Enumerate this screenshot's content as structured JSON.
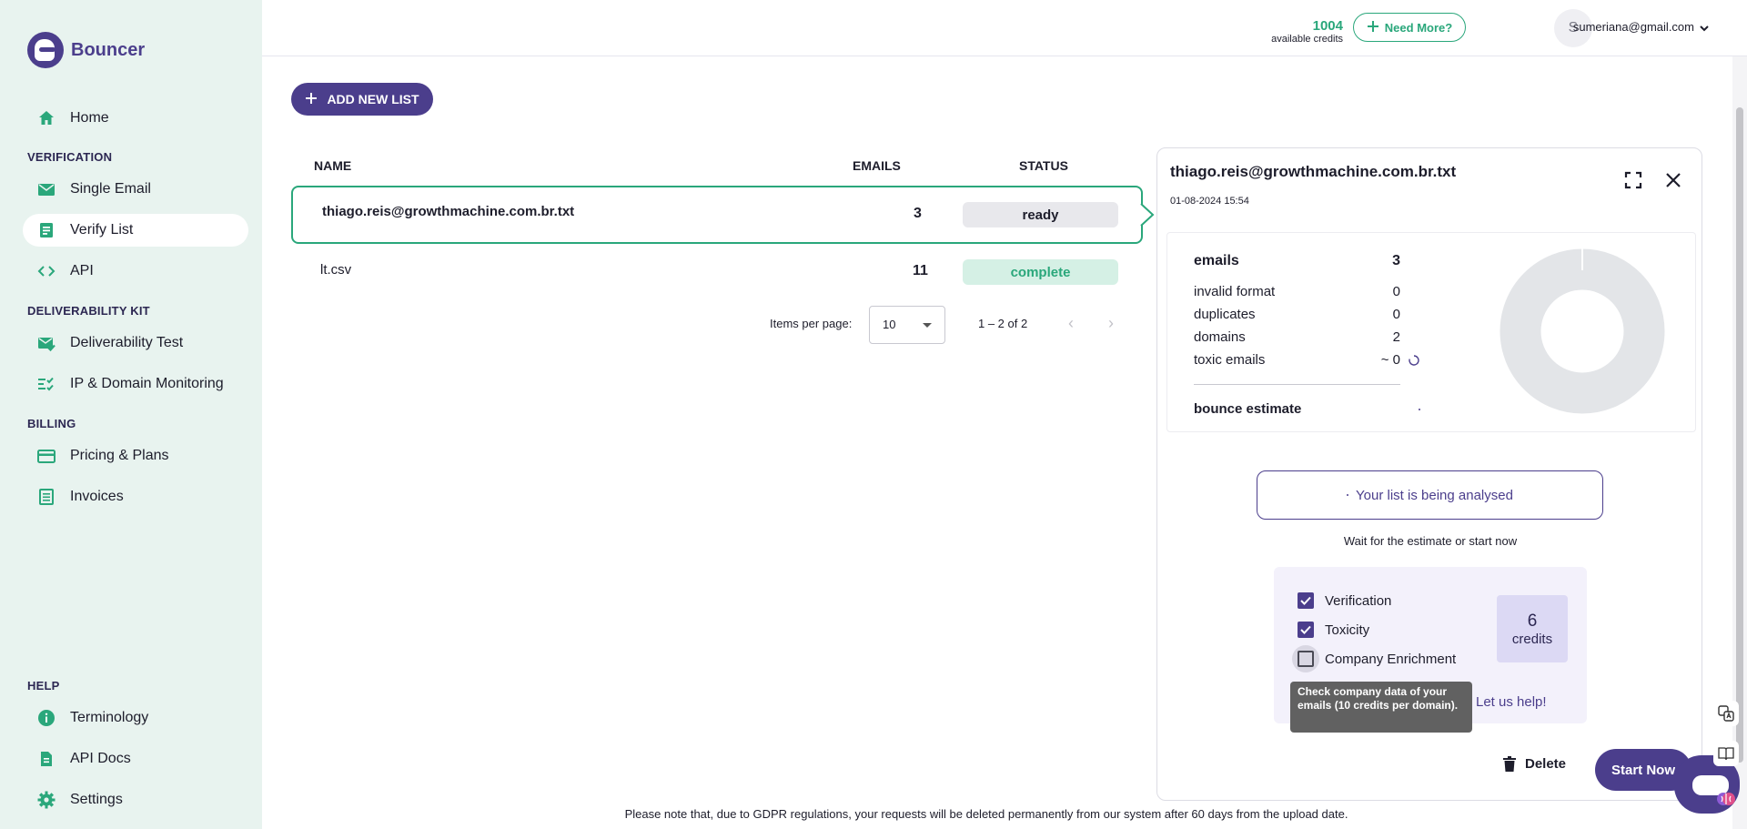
{
  "app": {
    "name": "Bouncer"
  },
  "sidebar": {
    "home": "Home",
    "sections": {
      "verification": "VERIFICATION",
      "deliverability": "DELIVERABILITY KIT",
      "billing": "BILLING",
      "help": "HELP"
    },
    "items": {
      "single_email": "Single Email",
      "verify_list": "Verify List",
      "api": "API",
      "deliverability_test": "Deliverability Test",
      "ip_domain": "IP & Domain Monitoring",
      "pricing": "Pricing & Plans",
      "invoices": "Invoices",
      "terminology": "Terminology",
      "api_docs": "API Docs",
      "settings": "Settings"
    }
  },
  "header": {
    "credits_value": "1004",
    "credits_label": "available credits",
    "need_more": "Need More?",
    "avatar_initial": "S",
    "user_email": "sumeriana@gmail.com"
  },
  "main": {
    "add_list": "ADD NEW LIST",
    "columns": {
      "name": "NAME",
      "emails": "EMAILS",
      "status": "STATUS"
    },
    "rows": [
      {
        "name": "thiago.reis@growthmachine.com.br.txt",
        "emails": "3",
        "status": "ready"
      },
      {
        "name": "lt.csv",
        "emails": "11",
        "status": "complete"
      }
    ],
    "pager": {
      "items_per_page_label": "Items per page:",
      "page_size": "10",
      "range": "1 – 2 of 2"
    }
  },
  "panel": {
    "title": "thiago.reis@growthmachine.com.br.txt",
    "date": "01-08-2024 15:54",
    "stats": {
      "emails_label": "emails",
      "emails_value": "3",
      "invalid_label": "invalid format",
      "invalid_value": "0",
      "duplicates_label": "duplicates",
      "duplicates_value": "0",
      "domains_label": "domains",
      "domains_value": "2",
      "toxic_label": "toxic emails",
      "toxic_value": "~ 0",
      "bounce_label": "bounce estimate"
    },
    "analysing": "Your list is being analysed",
    "wait_text": "Wait for the estimate or start now",
    "options": {
      "verification": "Verification",
      "toxicity": "Toxicity",
      "enrichment": "Company Enrichment",
      "verification_checked": true,
      "toxicity_checked": true,
      "enrichment_checked": false
    },
    "credits_number": "6",
    "credits_label": "credits",
    "help_link": "Let us help!",
    "tooltip": "Check company data of your emails (10 credits per domain).",
    "delete": "Delete",
    "start": "Start Now"
  },
  "footer": {
    "note": "Please note that, due to GDPR regulations, your requests will be deleted permanently from our system after 60 days from the upload date."
  },
  "colors": {
    "brand_purple": "#4b3e8c",
    "brand_green": "#2aa77b",
    "sidebar_bg": "#e8f3ef"
  }
}
